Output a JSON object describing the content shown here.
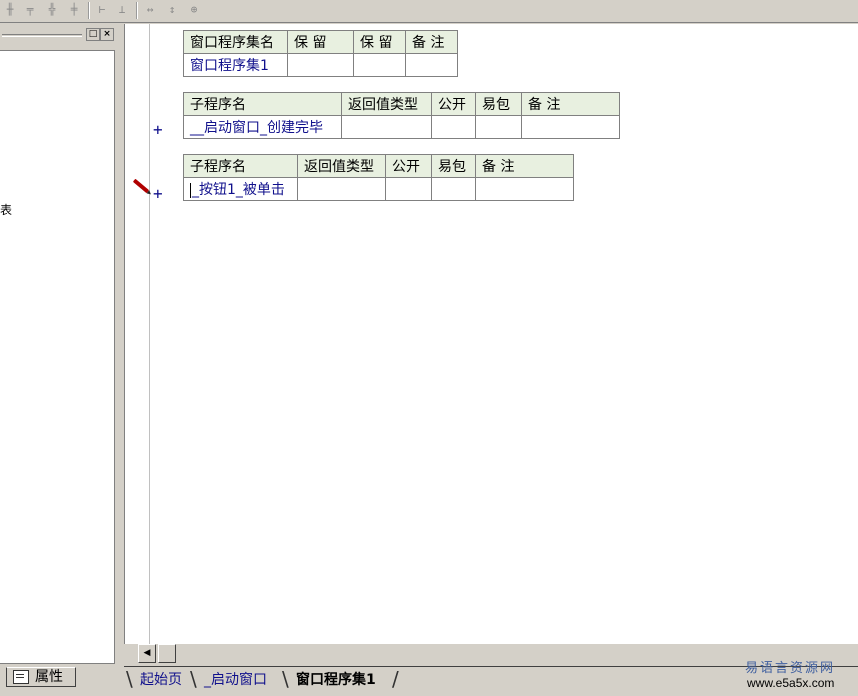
{
  "toolbar": {
    "icons": [
      "align-left-icon",
      "align-center-icon",
      "align-right-icon",
      "align-top-icon",
      "space-horizontal-icon",
      "space-vertical-icon",
      "same-width-icon",
      "same-height-icon",
      "same-size-icon"
    ]
  },
  "left_pane": {
    "truncated_text": "表",
    "properties_tab_label": "属性"
  },
  "table1": {
    "headers": [
      "窗口程序集名",
      "保 留",
      "保 留",
      "备 注"
    ],
    "row": [
      "窗口程序集1",
      "",
      "",
      ""
    ]
  },
  "table2": {
    "headers": [
      "子程序名",
      "返回值类型",
      "公开",
      "易包",
      "备 注"
    ],
    "row": [
      "__启动窗口_创建完毕",
      "",
      "",
      "",
      ""
    ]
  },
  "table3": {
    "headers": [
      "子程序名",
      "返回值类型",
      "公开",
      "易包",
      "备 注"
    ],
    "row": [
      "_按钮1_被单击",
      "",
      "",
      "",
      ""
    ]
  },
  "gutter": {
    "plus_symbol": "+"
  },
  "tabs": {
    "items": [
      "起始页",
      "_启动窗口",
      "窗口程序集1"
    ],
    "active_index": 2
  },
  "watermark": {
    "title": "易语言资源网",
    "url": "www.e5a5x.com"
  },
  "colors": {
    "header_bg": "#e8f0e0",
    "name_text": "#10108c",
    "chrome": "#d4d0c8"
  }
}
